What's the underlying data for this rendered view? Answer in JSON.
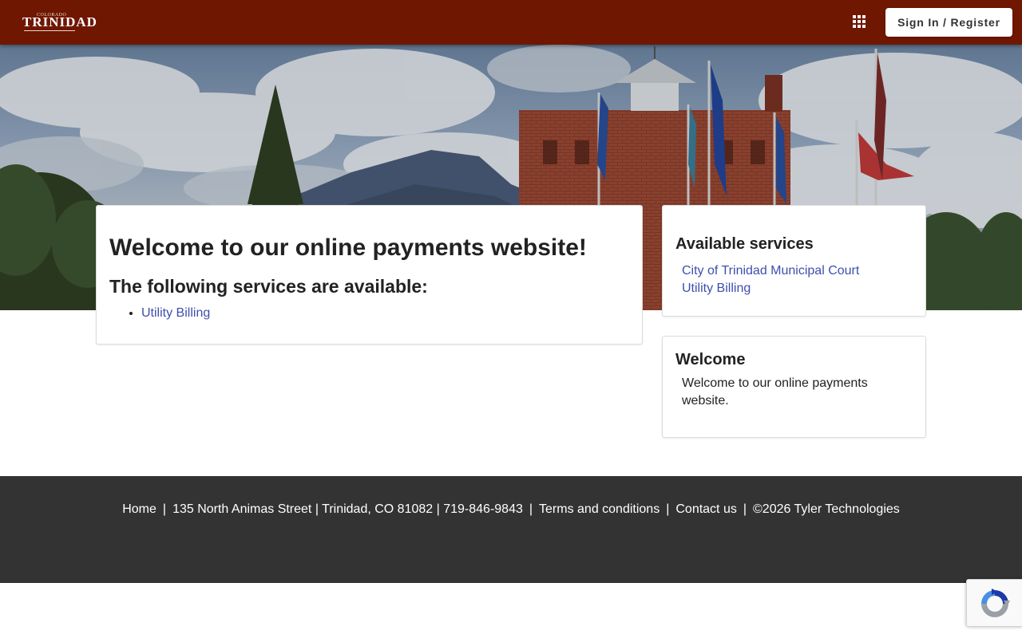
{
  "header": {
    "logo_small": "COLORADO",
    "logo_main": "TRINIDAD",
    "apps_icon": "apps-grid-icon",
    "signin_label": "Sign In / Register"
  },
  "main": {
    "title": "Welcome to our online payments website!",
    "subtitle": "The following services are available:",
    "services": [
      "Utility Billing"
    ]
  },
  "sidebar": {
    "available": {
      "title": "Available services",
      "links": [
        "City of Trinidad Municipal Court",
        "Utility Billing"
      ]
    },
    "welcome": {
      "title": "Welcome",
      "text": "Welcome to our online payments website."
    }
  },
  "footer": {
    "home": "Home",
    "separator": "|",
    "address": "135 North Animas Street | Trinidad, CO 81082 | 719-846-9843",
    "terms": "Terms and conditions",
    "contact": "Contact us",
    "copyright": "©2026 Tyler Technologies"
  },
  "colors": {
    "header_bg": "#6f1701",
    "link": "#3d4fad",
    "footer_bg": "#333333"
  },
  "recaptcha_icon": "recaptcha-icon"
}
